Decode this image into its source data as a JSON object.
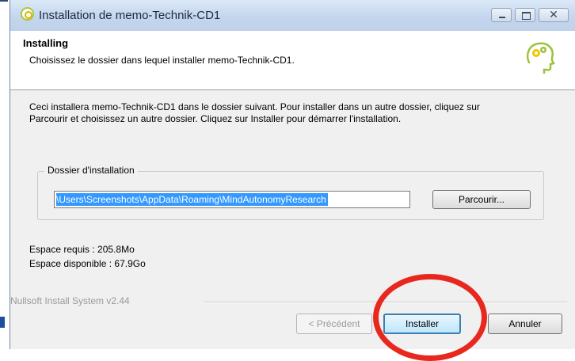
{
  "window": {
    "title": "Installation de memo-Technik-CD1",
    "controls": {
      "minimize": "minimize-icon",
      "maximize": "maximize-icon",
      "close": "close-icon"
    }
  },
  "header": {
    "title": "Installing",
    "subtitle": "Choisissez le dossier dans lequel installer memo-Technik-CD1."
  },
  "body": {
    "description": "Ceci installera memo-Technik-CD1 dans le dossier suivant. Pour installer dans un autre dossier, cliquez sur Parcourir et choisissez un autre dossier. Cliquez sur Installer pour démarrer l'installation."
  },
  "install_folder": {
    "group_label": "Dossier d'installation",
    "path_value": "\\Users\\Screenshots\\AppData\\Roaming\\MindAutonomyResearch",
    "browse_label": "Parcourir..."
  },
  "space": {
    "required": "Espace requis : 205.8Mo",
    "available": "Espace disponible : 67.9Go"
  },
  "footer": {
    "branding": "Nullsoft Install System v2.44",
    "prev_label": "< Précédent",
    "install_label": "Installer",
    "cancel_label": "Annuler"
  },
  "colors": {
    "selection": "#3399ff",
    "annotation_circle": "#e8281e",
    "default_button_border": "#3c7fb1"
  }
}
